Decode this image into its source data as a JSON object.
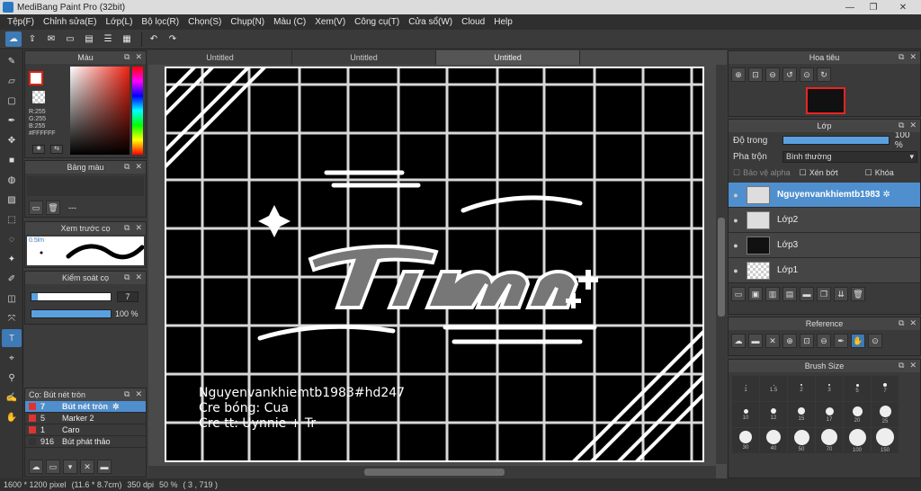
{
  "window": {
    "title": "MediBang Paint Pro (32bit)",
    "min": "—",
    "max": "❐",
    "close": "✕"
  },
  "menu": [
    "Tệp(F)",
    "Chỉnh sửa(E)",
    "Lớp(L)",
    "Bộ lọc(R)",
    "Chọn(S)",
    "Chụp(N)",
    "Màu (C)",
    "Xem(V)",
    "Công cụ(T)",
    "Cửa sổ(W)",
    "Cloud",
    "Help"
  ],
  "color_panel": {
    "title": "Màu",
    "r": "R:255",
    "g": "G:255",
    "b": "B:255",
    "hex": "#FFFFFF"
  },
  "palette_panel": {
    "title": "Bảng màu",
    "value": "---"
  },
  "preview_panel": {
    "title": "Xem trước cọ",
    "size": "0.5lm"
  },
  "control_panel": {
    "title": "Kiểm soát cọ",
    "size_value": "7",
    "opacity_value": "100 %",
    "size_fill": 0.08,
    "opacity_fill": 1.0
  },
  "brush_panel": {
    "title": "Cọ: Bút nét tròn",
    "items": [
      {
        "size": "7",
        "name": "Bút nét tròn",
        "color": "#d33",
        "selected": true
      },
      {
        "size": "5",
        "name": "Marker 2",
        "color": "#d33",
        "selected": false
      },
      {
        "size": "1",
        "name": "Caro",
        "color": "#d33",
        "selected": false
      },
      {
        "size": "916",
        "name": "Bút phát thảo",
        "color": "#333",
        "selected": false
      }
    ]
  },
  "doc_tabs": [
    "Untitled",
    "Untitled",
    "Untitled"
  ],
  "credits": [
    "Nguyenvankhiemtb1983#hd247",
    "Cre bóng: Cua",
    "Cre tt: Uynnie + Tr"
  ],
  "status": {
    "size": "1600 * 1200 pixel",
    "cm": "(11.6 * 8.7cm)",
    "dpi": "350 dpi",
    "zoom": "50 %",
    "coords": "( 3 , 719 )"
  },
  "navigator": {
    "title": "Hoa tiêu"
  },
  "layer_panel": {
    "title": "Lớp",
    "opacity_label": "Độ trong",
    "opacity_value": "100 %",
    "opacity_fill": 1.0,
    "blend_label": "Pha trộn",
    "blend_value": "Bình thường",
    "protect_alpha": "Bảo vệ alpha",
    "clipping": "Xén bớt",
    "lock": "Khóa",
    "layers": [
      {
        "name": "Nguyenvankhiemtb1983",
        "selected": true
      },
      {
        "name": "Lớp2",
        "selected": false
      },
      {
        "name": "Lớp3",
        "selected": false
      },
      {
        "name": "Lớp1",
        "selected": false
      }
    ]
  },
  "reference_panel": {
    "title": "Reference"
  },
  "brush_size_panel": {
    "title": "Brush Size",
    "sizes": [
      "1",
      "1.5",
      "2",
      "3",
      "5",
      "7",
      "10",
      "12",
      "15",
      "17",
      "20",
      "25",
      "30",
      "40",
      "50",
      "70",
      "100",
      "150"
    ]
  }
}
